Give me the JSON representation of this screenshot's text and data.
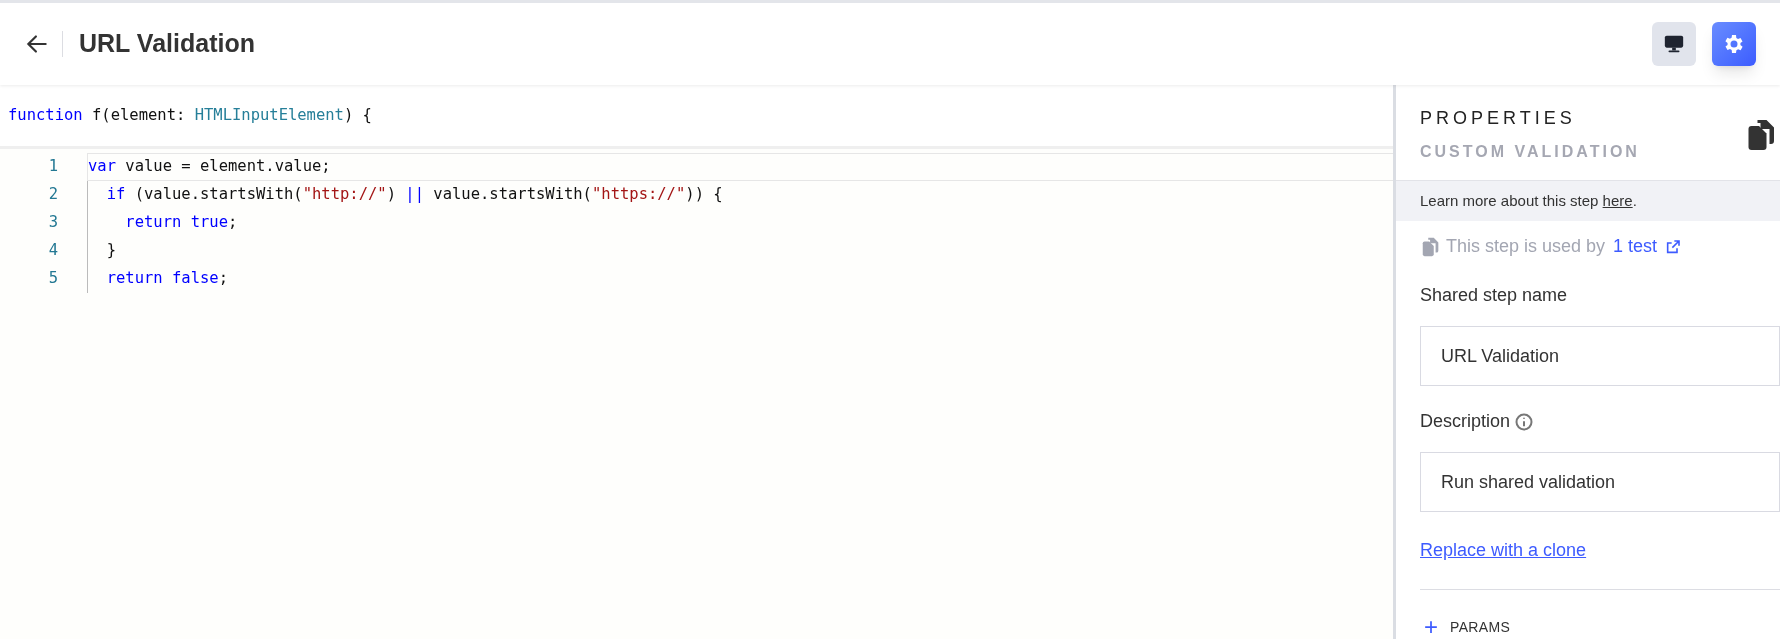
{
  "header": {
    "title": "URL Validation",
    "buttons": [
      {
        "kind": "monitor",
        "selected": false
      },
      {
        "kind": "gear",
        "selected": true
      }
    ]
  },
  "code": {
    "signature": [
      {
        "kind": "keyword",
        "text": "function"
      },
      {
        "kind": "plain",
        "text": " f(element: "
      },
      {
        "kind": "type",
        "text": "HTMLInputElement"
      },
      {
        "kind": "plain",
        "text": ") {"
      }
    ],
    "lines": [
      {
        "number": "1",
        "tokens": [
          {
            "kind": "keyword",
            "text": "var"
          },
          {
            "kind": "plain",
            "text": " value = element.value;"
          }
        ]
      },
      {
        "number": "2",
        "tokens": [
          {
            "kind": "keyword",
            "text": "  if"
          },
          {
            "kind": "plain",
            "text": " (value.startsWith("
          },
          {
            "kind": "string",
            "text": "\"http://\""
          },
          {
            "kind": "plain",
            "text": ") "
          },
          {
            "kind": "keyword",
            "text": "||"
          },
          {
            "kind": "plain",
            "text": " value.startsWith("
          },
          {
            "kind": "string",
            "text": "\"https://\""
          },
          {
            "kind": "plain",
            "text": ")) {"
          }
        ]
      },
      {
        "number": "3",
        "tokens": [
          {
            "kind": "keyword",
            "text": "    return true"
          },
          {
            "kind": "plain",
            "text": ";"
          }
        ]
      },
      {
        "number": "4",
        "tokens": [
          {
            "kind": "plain",
            "text": "  }"
          }
        ]
      },
      {
        "number": "5",
        "tokens": [
          {
            "kind": "keyword",
            "text": "  return false"
          },
          {
            "kind": "plain",
            "text": ";"
          }
        ]
      }
    ]
  },
  "properties": {
    "title": "PROPERTIES",
    "subtitle": "CUSTOM VALIDATION",
    "learn_more": {
      "text": "Learn more about this step ",
      "link": "here",
      "end": "."
    },
    "usage": {
      "text": "This step is used by",
      "link": "1 test"
    },
    "fields": [
      {
        "label": "Shared step name",
        "info": false,
        "value": "URL Validation"
      },
      {
        "label": "Description",
        "info": true,
        "value": "Run shared validation"
      }
    ],
    "clone_link": "Replace with a clone",
    "params": {
      "icon": "+",
      "label": "PARAMS"
    }
  }
}
